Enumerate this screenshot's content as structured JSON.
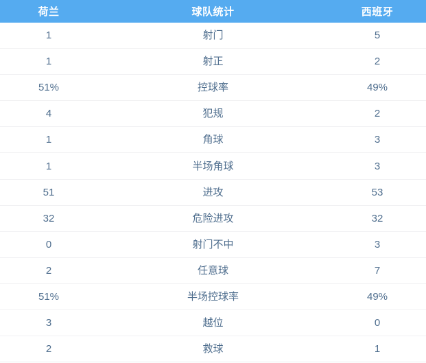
{
  "header": {
    "home_team": "荷兰",
    "title": "球队统计",
    "away_team": "西班牙"
  },
  "rows": [
    {
      "home": "1",
      "label": "射门",
      "away": "5"
    },
    {
      "home": "1",
      "label": "射正",
      "away": "2"
    },
    {
      "home": "51%",
      "label": "控球率",
      "away": "49%"
    },
    {
      "home": "4",
      "label": "犯规",
      "away": "2"
    },
    {
      "home": "1",
      "label": "角球",
      "away": "3"
    },
    {
      "home": "1",
      "label": "半场角球",
      "away": "3"
    },
    {
      "home": "51",
      "label": "进攻",
      "away": "53"
    },
    {
      "home": "32",
      "label": "危险进攻",
      "away": "32"
    },
    {
      "home": "0",
      "label": "射门不中",
      "away": "3"
    },
    {
      "home": "2",
      "label": "任意球",
      "away": "7"
    },
    {
      "home": "51%",
      "label": "半场控球率",
      "away": "49%"
    },
    {
      "home": "3",
      "label": "越位",
      "away": "0"
    },
    {
      "home": "2",
      "label": "救球",
      "away": "1"
    }
  ],
  "colors": {
    "header_background": "#55abf0",
    "header_text": "#ffffff",
    "value_text": "#4f6e8e",
    "row_divider": "#f1f1f3",
    "panel_background": "#ffffff"
  }
}
